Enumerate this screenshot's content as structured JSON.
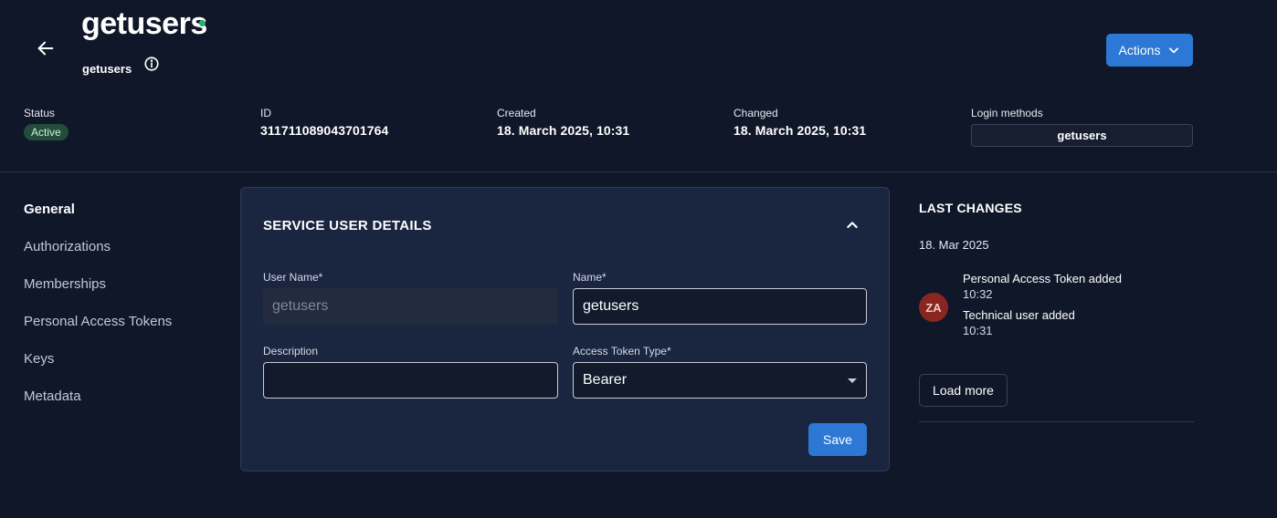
{
  "header": {
    "title": "getusers",
    "subtitle": "getusers",
    "actions_label": "Actions",
    "status_color": "#22b26a",
    "back_icon": "arrow-left-icon",
    "info_icon": "info-icon"
  },
  "meta": {
    "status_label": "Status",
    "status_value": "Active",
    "id_label": "ID",
    "id_value": "311711089043701764",
    "created_label": "Created",
    "created_value": "18. March 2025, 10:31",
    "changed_label": "Changed",
    "changed_value": "18. March 2025, 10:31",
    "login_label": "Login methods",
    "login_value": "getusers"
  },
  "nav": {
    "items": [
      "General",
      "Authorizations",
      "Memberships",
      "Personal Access Tokens",
      "Keys",
      "Metadata"
    ],
    "active": "General"
  },
  "card": {
    "title": "SERVICE USER DETAILS",
    "username_label": "User Name*",
    "username_value": "getusers",
    "name_label": "Name*",
    "name_value": "getusers",
    "description_label": "Description",
    "description_value": "",
    "token_type_label": "Access Token Type*",
    "token_type_value": "Bearer",
    "save_label": "Save"
  },
  "changes": {
    "title": "LAST CHANGES",
    "date": "18. Mar 2025",
    "avatar_initials": "ZA",
    "entries": [
      {
        "text": "Personal Access Token added",
        "time": "10:32"
      },
      {
        "text": "Technical user added",
        "time": "10:31"
      }
    ],
    "load_more_label": "Load more"
  },
  "colors": {
    "background": "#101729",
    "card": "#1a2540",
    "accent": "#2c78d4",
    "avatar": "#8a2621",
    "badge": "#234d39"
  }
}
